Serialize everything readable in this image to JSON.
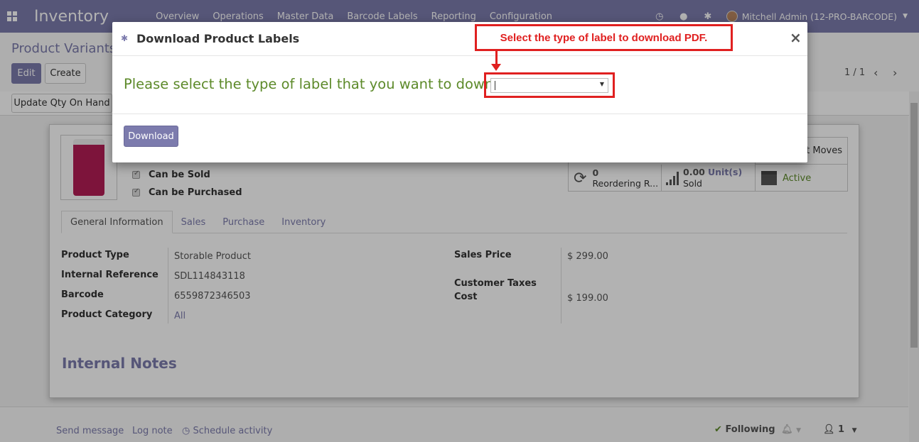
{
  "navbar": {
    "brand": "Inventory",
    "menu": [
      "Overview",
      "Operations",
      "Master Data",
      "Barcode Labels",
      "Reporting",
      "Configuration"
    ],
    "user": "Mitchell Admin (12-PRO-BARCODE)"
  },
  "control_panel": {
    "breadcrumb": "Product Variants /",
    "edit_label": "Edit",
    "create_label": "Create",
    "pager": "1 / 1",
    "update_qty_label": "Update Qty On Hand"
  },
  "form": {
    "can_be_sold": "Can be Sold",
    "can_be_purchased": "Can be Purchased",
    "smart_buttons": {
      "product_moves": "ct Moves",
      "reordering_count": "0",
      "reordering_label": "Reordering R...",
      "sold_qty": "0.00",
      "sold_unit": "Unit(s)",
      "sold_label": "Sold",
      "active_label": "Active"
    },
    "tabs": [
      "General Information",
      "Sales",
      "Purchase",
      "Inventory"
    ],
    "fields": {
      "product_type_label": "Product Type",
      "product_type_value": "Storable Product",
      "internal_ref_label": "Internal Reference",
      "internal_ref_value": "SDL114843118",
      "barcode_label": "Barcode",
      "barcode_value": "6559872346503",
      "category_label": "Product Category",
      "category_value": "All",
      "sales_price_label": "Sales Price",
      "sales_price_value": "$ 299.00",
      "customer_taxes_label": "Customer Taxes",
      "cost_label": "Cost",
      "cost_value": "$ 199.00"
    },
    "internal_notes": "Internal Notes"
  },
  "chatter": {
    "send_message": "Send message",
    "log_note": "Log note",
    "schedule_activity": "Schedule activity",
    "following": "Following",
    "followers_count": "1"
  },
  "modal": {
    "title": "Download Product Labels",
    "close": "×",
    "prompt": "Please select the type of label that you want to download",
    "select_value": "",
    "download_label": "Download"
  },
  "annotation": {
    "callout": "Select the type of label to download PDF."
  }
}
